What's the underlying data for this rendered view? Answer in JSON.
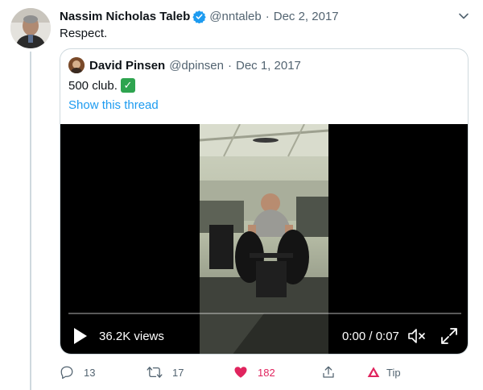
{
  "tweet": {
    "author_name": "Nassim Nicholas Taleb",
    "author_handle": "@nntaleb",
    "separator": "·",
    "date": "Dec 2, 2017",
    "text": "Respect.",
    "verified": true
  },
  "quote": {
    "author_name": "David Pinsen",
    "author_handle": "@dpinsen",
    "separator": "·",
    "date": "Dec 1, 2017",
    "text": "500 club.",
    "check_glyph": "✓",
    "thread_link": "Show this thread"
  },
  "video": {
    "views": "36.2K views",
    "time": "0:00 / 0:07",
    "progress": 0.0,
    "play_icon": "play-icon",
    "mute_icon": "muted-speaker-icon",
    "fullscreen_icon": "expand-icon"
  },
  "actions": {
    "reply_count": "13",
    "retweet_count": "17",
    "like_count": "182",
    "tip_label": "Tip"
  },
  "colors": {
    "link": "#1d9bf0",
    "like": "#e0245e",
    "verified": "#1d9bf0",
    "muted_text": "#536471",
    "tip": "#e0245e"
  }
}
